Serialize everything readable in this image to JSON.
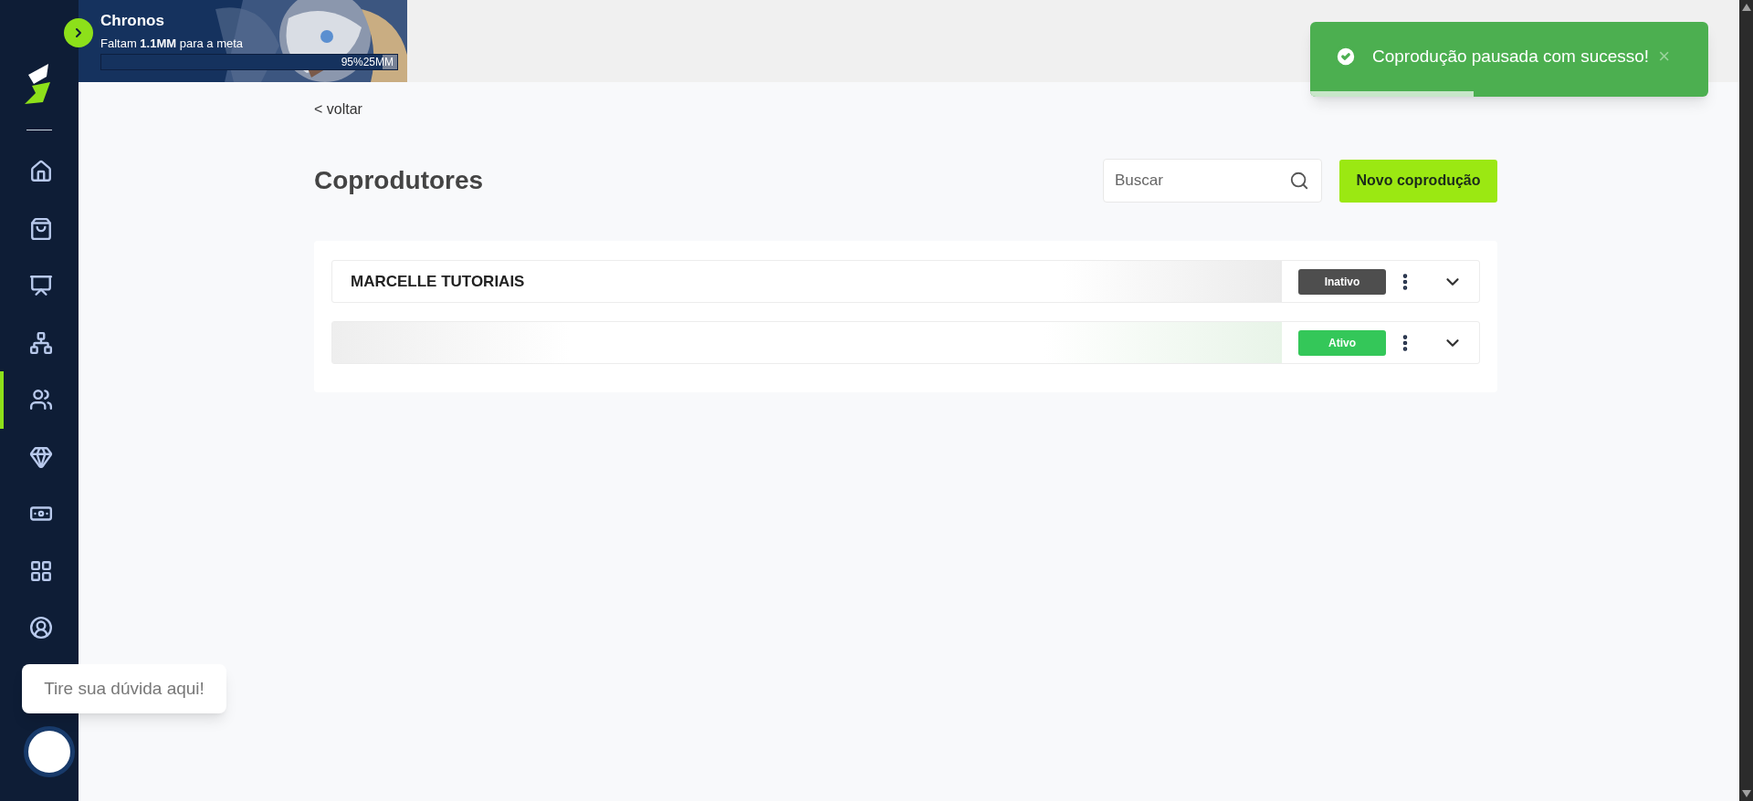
{
  "sidebar": {
    "items": [
      {
        "kind": "home",
        "selected": false
      },
      {
        "kind": "bag",
        "selected": false
      },
      {
        "kind": "presentation",
        "selected": false
      },
      {
        "kind": "network",
        "selected": false
      },
      {
        "kind": "people",
        "selected": true
      },
      {
        "kind": "gem",
        "selected": false
      },
      {
        "kind": "money",
        "selected": false
      },
      {
        "kind": "grid",
        "selected": false
      },
      {
        "kind": "user",
        "selected": false
      }
    ]
  },
  "goal_banner": {
    "title": "Chronos",
    "subtitle": "Faltam **1.1MM** para a meta",
    "progress": {
      "level": 0.95,
      "reading": "95%25MM"
    }
  },
  "back_link": "< voltar",
  "page_title": "Coprodutores",
  "search": {
    "placeholder": "Buscar"
  },
  "new_button": "Novo coprodução",
  "coproducers": [
    {
      "name": "MARCELLE TUTORIAIS",
      "status": "Inativo",
      "active": false
    },
    {
      "status": "Ativo",
      "active": true
    }
  ],
  "toast": {
    "message": "Coprodução pausada com sucesso!",
    "close": "×",
    "level": 0.41
  },
  "help_bubble": "Tire sua dúvida aqui!"
}
